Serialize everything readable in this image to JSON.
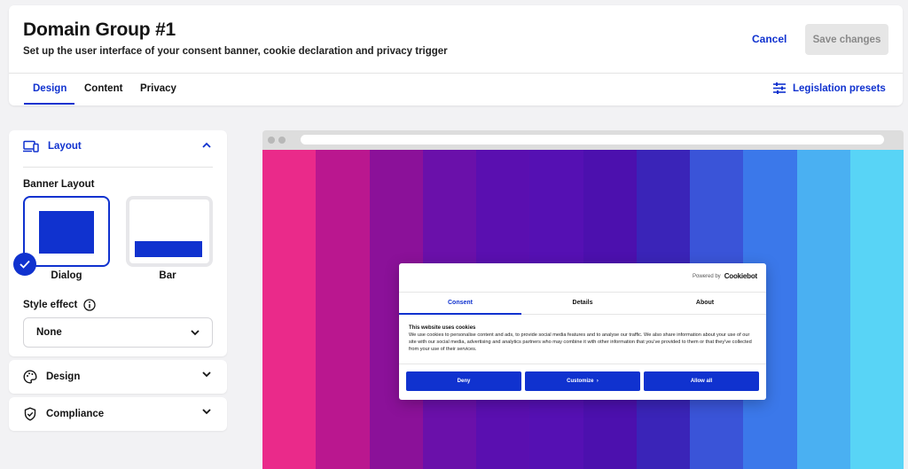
{
  "header": {
    "title": "Domain Group #1",
    "subtitle": "Set up the user interface of your consent banner, cookie declaration and privacy trigger",
    "cancel_label": "Cancel",
    "save_label": "Save changes",
    "tabs": [
      {
        "label": "Design",
        "active": true
      },
      {
        "label": "Content",
        "active": false
      },
      {
        "label": "Privacy",
        "active": false
      }
    ],
    "presets_label": "Legislation presets"
  },
  "panel": {
    "layout": {
      "title": "Layout",
      "expanded": true,
      "banner_layout_label": "Banner Layout",
      "options": [
        {
          "label": "Dialog",
          "selected": true
        },
        {
          "label": "Bar",
          "selected": false
        }
      ],
      "style_effect_label": "Style effect",
      "style_effect_value": "None"
    },
    "design": {
      "title": "Design",
      "expanded": false
    },
    "compliance": {
      "title": "Compliance",
      "expanded": false
    }
  },
  "preview": {
    "gradient_colors": [
      "#ea2a8a",
      "#ba178f",
      "#8b1199",
      "#6a10aa",
      "#5a0fb0",
      "#5510b3",
      "#4c10ae",
      "#3a24b8",
      "#3a54d8",
      "#3b78ea",
      "#4ab0f2",
      "#58d4f6"
    ],
    "dialog": {
      "powered_by": "Powered by",
      "brand": "Cookiebot",
      "tabs": [
        {
          "label": "Consent",
          "active": true
        },
        {
          "label": "Details",
          "active": false
        },
        {
          "label": "About",
          "active": false
        }
      ],
      "heading": "This website uses cookies",
      "body": "We use cookies to personalise content and ads, to provide social media features and to analyse our traffic. We also share information about your use of our site with our social media, advertising and analytics partners who may combine it with other information that you've provided to them or that they've collected from your use of their services.",
      "buttons": {
        "deny": "Deny",
        "customize": "Customize",
        "allow_all": "Allow all"
      }
    }
  },
  "colors": {
    "accent": "#1032cf",
    "disabled_bg": "#e6e6e6"
  }
}
